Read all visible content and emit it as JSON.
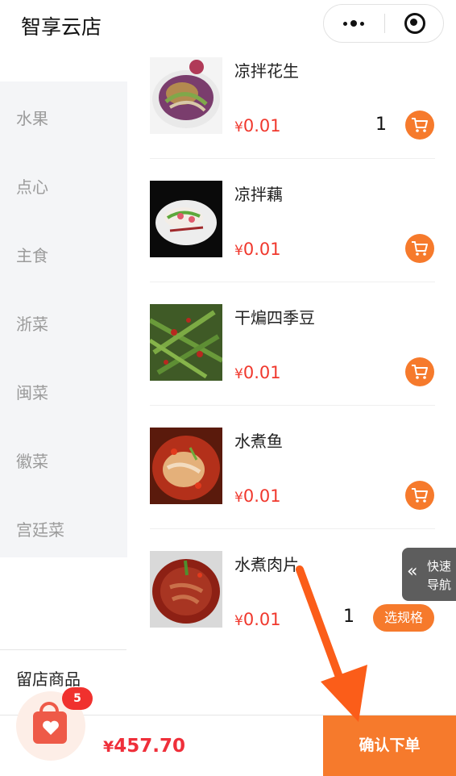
{
  "app": {
    "title": "智享云店"
  },
  "capsule": {
    "more_icon": "more-dots-icon",
    "close_icon": "target-close-icon"
  },
  "sidebar": {
    "categories": [
      {
        "label": "水果"
      },
      {
        "label": "点心"
      },
      {
        "label": "主食"
      },
      {
        "label": "浙菜"
      },
      {
        "label": "闽菜"
      },
      {
        "label": "徽菜"
      },
      {
        "label": "宫廷菜"
      }
    ],
    "stored_goods_label": "留店商品"
  },
  "products": [
    {
      "name": "凉拌花生",
      "currency": "¥",
      "price": "0.01",
      "quantity": "1",
      "action": "cart-icon"
    },
    {
      "name": "凉拌藕",
      "currency": "¥",
      "price": "0.01",
      "action": "cart-icon"
    },
    {
      "name": "干煸四季豆",
      "currency": "¥",
      "price": "0.01",
      "action": "cart-icon"
    },
    {
      "name": "水煮鱼",
      "currency": "¥",
      "price": "0.01",
      "action": "cart-icon"
    },
    {
      "name": "水煮肉片",
      "currency": "¥",
      "price": "0.01",
      "quantity": "1",
      "action_label": "选规格"
    }
  ],
  "quick_nav": {
    "line1": "快速",
    "line2": "导航",
    "icon": "double-chevron-left-icon"
  },
  "cart": {
    "badge_count": "5",
    "icon": "shopping-bag-heart-icon"
  },
  "bottom_bar": {
    "currency": "¥",
    "total": "457.70",
    "confirm_label": "确认下单"
  },
  "colors": {
    "accent": "#f67a2c",
    "price_red": "#f0382d",
    "sidebar_bg": "#f4f5f7",
    "badge_red": "#f0312e"
  }
}
